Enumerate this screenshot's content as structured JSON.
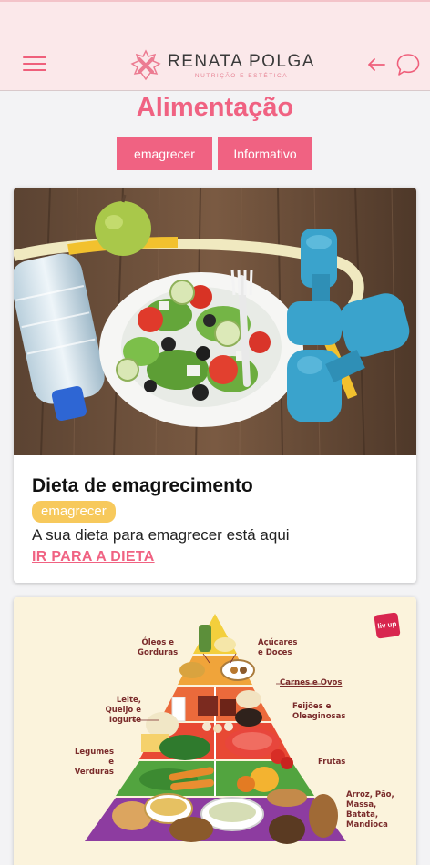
{
  "header": {
    "brand_name": "RENATA POLGA",
    "brand_tagline": "NUTRIÇÃO E ESTÉTICA"
  },
  "page": {
    "title": "Alimentação"
  },
  "filters": [
    {
      "label": "emagrecer"
    },
    {
      "label": "Informativo"
    }
  ],
  "cards": [
    {
      "title": "Dieta de emagrecimento",
      "badge": "emagrecer",
      "description": "A sua dieta para emagrecer está aqui",
      "link": "IR PARA A DIETA"
    }
  ],
  "pyramid": {
    "logo": "liv up",
    "labels": {
      "oleos": "Óleos e Gorduras",
      "acucares": "Açúcares e Doces",
      "carnes": "Carnes e Ovos",
      "leite": "Leite, Queijo e Iogurte",
      "feijoes": "Feijões e Oleaginosas",
      "legumes": "Legumes e Verduras",
      "frutas": "Frutas",
      "arroz": "Arroz, Pão, Massa, Batata, Mandioca"
    }
  },
  "colors": {
    "accent": "#f06282",
    "header_bg": "#fbe8ea",
    "badge": "#f7c95c"
  },
  "icons": [
    "menu-icon",
    "brand-logo-icon",
    "back-arrow-icon",
    "chat-icon"
  ]
}
